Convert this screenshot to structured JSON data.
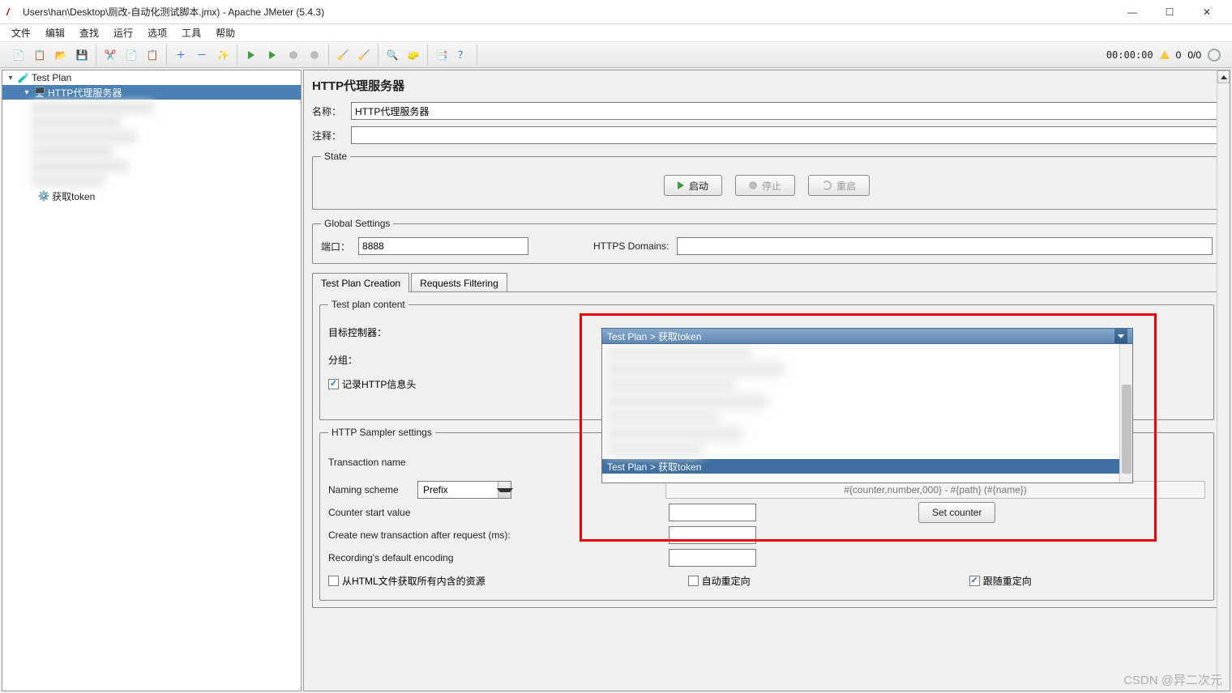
{
  "window": {
    "title": "Users\\han\\Desktop\\厕改-自动化测试脚本.jmx) - Apache JMeter (5.4.3)"
  },
  "menu": [
    "文件",
    "编辑",
    "查找",
    "运行",
    "选项",
    "工具",
    "帮助"
  ],
  "toolbar_right": {
    "time": "00:00:00",
    "warn_count": "0",
    "ratio": "0/0"
  },
  "tree": {
    "root": "Test Plan",
    "selected": "HTTP代理服务器",
    "leaf": "获取token"
  },
  "panel": {
    "title": "HTTP代理服务器",
    "name_label": "名称：",
    "name_value": "HTTP代理服务器",
    "comment_label": "注释：",
    "comment_value": "",
    "state_legend": "State",
    "start": "启动",
    "stop": "停止",
    "restart": "重启",
    "global_legend": "Global Settings",
    "port_label": "端口：",
    "port_value": "8888",
    "https_label": "HTTPS Domains:",
    "https_value": "",
    "tabs": {
      "plan": "Test Plan Creation",
      "req": "Requests Filtering"
    },
    "test_plan_content": "Test plan content",
    "target_controller": "目标控制器：",
    "target_value": "Test Plan > 获取token",
    "dropdown_selected": "Test Plan > 获取token",
    "grouping": "分组：",
    "record_headers": "记录HTTP信息头",
    "sampler_legend": "HTTP Sampler settings",
    "txn_name_label": "Transaction name",
    "naming_scheme_label": "Naming scheme",
    "naming_scheme_value": "Prefix",
    "format_placeholder": "#{counter,number,000} - #{path} (#{name})",
    "counter_start_label": "Counter start value",
    "set_counter": "Set counter",
    "create_txn_label": "Create new transaction after request (ms):",
    "recording_enc_label": "Recording's default encoding",
    "retrieve_html": "从HTML文件获取所有内含的资源",
    "auto_redirect": "自动重定向",
    "follow_redirect": "跟随重定向"
  },
  "watermark": "CSDN @异二次元"
}
